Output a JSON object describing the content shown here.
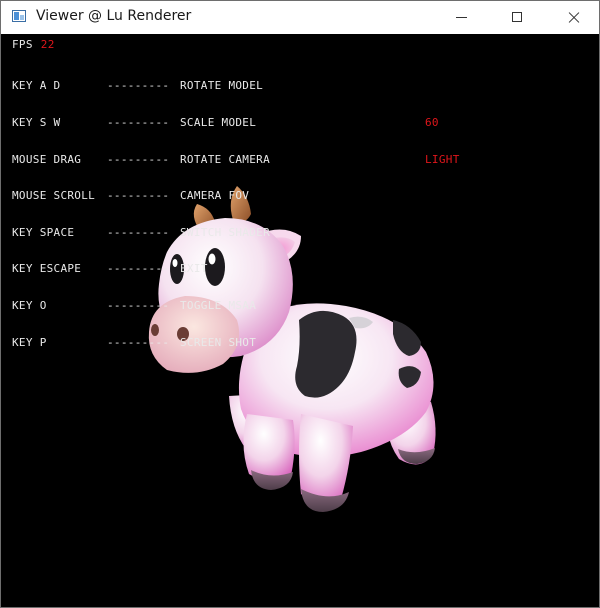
{
  "window": {
    "title": "Viewer @ Lu Renderer"
  },
  "hud": {
    "fps_label": "FPS",
    "fps_value": "22",
    "controls": [
      {
        "key": "KEY A D",
        "sep": "---------",
        "action": "ROTATE MODEL"
      },
      {
        "key": "KEY S W",
        "sep": "---------",
        "action": "SCALE MODEL"
      },
      {
        "key": "MOUSE DRAG",
        "sep": "---------",
        "action": "ROTATE CAMERA"
      },
      {
        "key": "MOUSE SCROLL",
        "sep": "---------",
        "action": "CAMERA FOV"
      },
      {
        "key": "KEY SPACE",
        "sep": "---------",
        "action": "SWITCH SHADER"
      },
      {
        "key": "KEY ESCAPE",
        "sep": "---------",
        "action": "EXIT"
      },
      {
        "key": "KEY O",
        "sep": "---------",
        "action": "TOGGLE MSAA"
      },
      {
        "key": "KEY P",
        "sep": "---------",
        "action": "SCREEN SHOT"
      }
    ],
    "fov_value": "60",
    "shader_name": "LIGHT"
  },
  "scene": {
    "model": "cow-model",
    "colors": {
      "background": "#000000",
      "body": "#f6dcef",
      "spots": "#2a2a2e",
      "horns": "#b06a3a",
      "hud_text": "#e9e9e9",
      "hud_accent": "#e0161b"
    }
  }
}
